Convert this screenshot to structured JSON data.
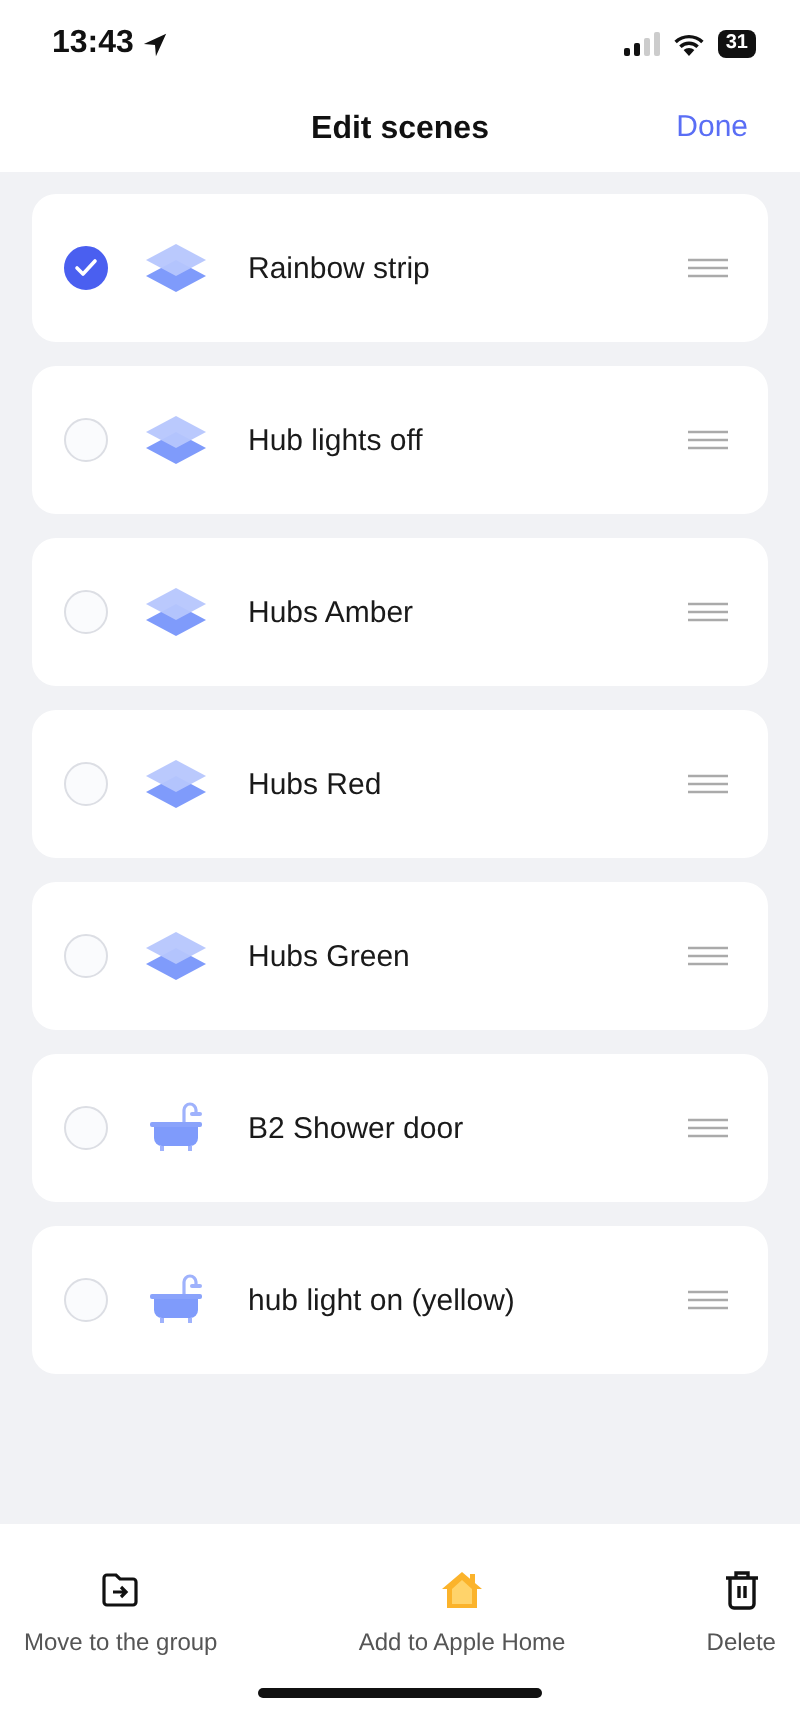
{
  "status_bar": {
    "time": "13:43",
    "battery": "31"
  },
  "nav": {
    "title": "Edit scenes",
    "action": "Done"
  },
  "scenes": [
    {
      "name": "Rainbow strip",
      "selected": true,
      "kind": "layers"
    },
    {
      "name": "Hub lights off",
      "selected": false,
      "kind": "layers"
    },
    {
      "name": "Hubs Amber",
      "selected": false,
      "kind": "layers"
    },
    {
      "name": "Hubs Red",
      "selected": false,
      "kind": "layers"
    },
    {
      "name": "Hubs Green",
      "selected": false,
      "kind": "layers"
    },
    {
      "name": "B2 Shower door",
      "selected": false,
      "kind": "bath"
    },
    {
      "name": "hub light on (yellow)",
      "selected": false,
      "kind": "bath"
    }
  ],
  "actions": [
    {
      "label": "Move to the group",
      "kind": "move"
    },
    {
      "label": "Add to Apple Home",
      "kind": "home"
    },
    {
      "label": "Delete",
      "kind": "delete"
    }
  ]
}
